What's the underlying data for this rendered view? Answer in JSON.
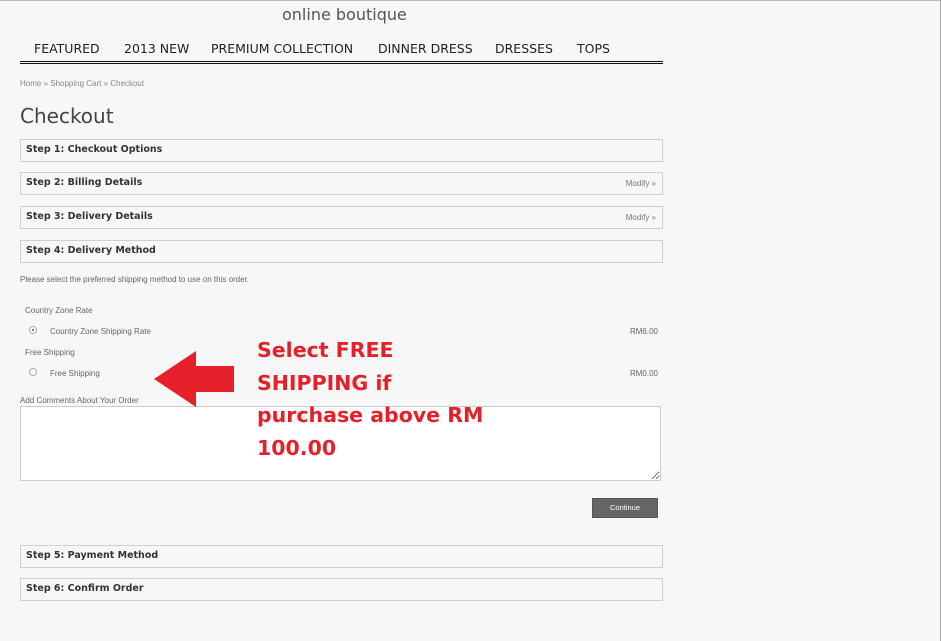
{
  "header": {
    "logo": "online boutique"
  },
  "nav": {
    "items": [
      "FEATURED",
      "2013 NEW",
      "PREMIUM COLLECTION",
      "DINNER DRESS",
      "DRESSES",
      "TOPS"
    ]
  },
  "breadcrumb": "Home » Shopping Cart » Checkout",
  "page_title": "Checkout",
  "steps": [
    {
      "title": "Step 1: Checkout Options",
      "modify": ""
    },
    {
      "title": "Step 2: Billing Details",
      "modify": "Modify »"
    },
    {
      "title": "Step 3: Delivery Details",
      "modify": "Modify »"
    },
    {
      "title": "Step 4: Delivery Method",
      "modify": ""
    },
    {
      "title": "Step 5: Payment Method",
      "modify": ""
    },
    {
      "title": "Step 6: Confirm Order",
      "modify": ""
    }
  ],
  "delivery": {
    "instruction": "Please select the preferred shipping method to use on this order.",
    "groups": [
      {
        "heading": "Country Zone Rate",
        "option": "Country Zone Shipping Rate",
        "price": "RM6.00",
        "selected": true
      },
      {
        "heading": "Free Shipping",
        "option": "Free Shipping",
        "price": "RM0.00",
        "selected": false
      }
    ],
    "comments_label": "Add Comments About Your Order",
    "comments_value": "",
    "continue_label": "Continue"
  },
  "annotation": {
    "text_lines": [
      "Select FREE",
      "SHIPPING if",
      "purchase above RM",
      "100.00"
    ],
    "color": "#e5202a",
    "icon": "arrow-left-icon"
  }
}
